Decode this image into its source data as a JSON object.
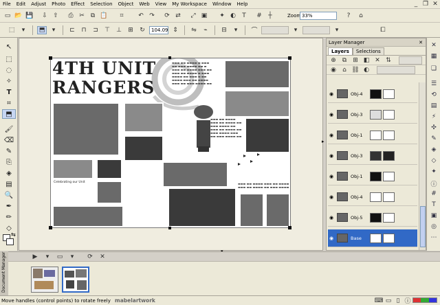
{
  "menu": {
    "items": [
      {
        "label": "File",
        "u": "F"
      },
      {
        "label": "Edit",
        "u": "E"
      },
      {
        "label": "Adjust",
        "u": "A"
      },
      {
        "label": "Photo",
        "u": "P"
      },
      {
        "label": "Effect",
        "u": "f"
      },
      {
        "label": "Selection",
        "u": "S"
      },
      {
        "label": "Object",
        "u": "O"
      },
      {
        "label": "Web",
        "u": "W"
      },
      {
        "label": "View",
        "u": "V"
      },
      {
        "label": "My Workspace",
        "u": "M"
      },
      {
        "label": "Window",
        "u": "W"
      },
      {
        "label": "Help",
        "u": "H"
      }
    ],
    "zoom_label": "Zoom",
    "zoom_value": "33%"
  },
  "toolbar2": {
    "angle_value": "104.09"
  },
  "canvas": {
    "headline_line1": "4TH UNIT",
    "headline_line2": "RANGERS",
    "caption": "Celebrating our Unit"
  },
  "layer_manager": {
    "title": "Layer Manager",
    "tabs": [
      "Layers",
      "Selections"
    ],
    "layers": [
      {
        "name": "Obj-4",
        "swatch1": "#111111",
        "swatch2": "#ffffff",
        "selected": false
      },
      {
        "name": "Obj-3",
        "swatch1": "#dddddd",
        "swatch2": "#ffffff",
        "selected": false
      },
      {
        "name": "Obj-1",
        "swatch1": "#ffffff",
        "swatch2": "#ffffff",
        "selected": false
      },
      {
        "name": "Obj-3",
        "swatch1": "#333333",
        "swatch2": "#222222",
        "selected": false
      },
      {
        "name": "Obj-1",
        "swatch1": "#111111",
        "swatch2": "#ffffff",
        "selected": false
      },
      {
        "name": "Obj-4",
        "swatch1": "#ffffff",
        "swatch2": "#ffffff",
        "selected": false
      },
      {
        "name": "Obj-5",
        "swatch1": "#111111",
        "swatch2": "#ffffff",
        "selected": false
      },
      {
        "name": "Base",
        "swatch1": "#ffffff",
        "swatch2": "#ffffff",
        "selected": true
      }
    ]
  },
  "document_manager": {
    "label": "Document Manager"
  },
  "status": {
    "text": "Move handles (control points) to rotate freely",
    "watermark": "mabelartwork"
  },
  "colors": {
    "selection": "#3169c6",
    "chrome": "#ece9d8"
  }
}
